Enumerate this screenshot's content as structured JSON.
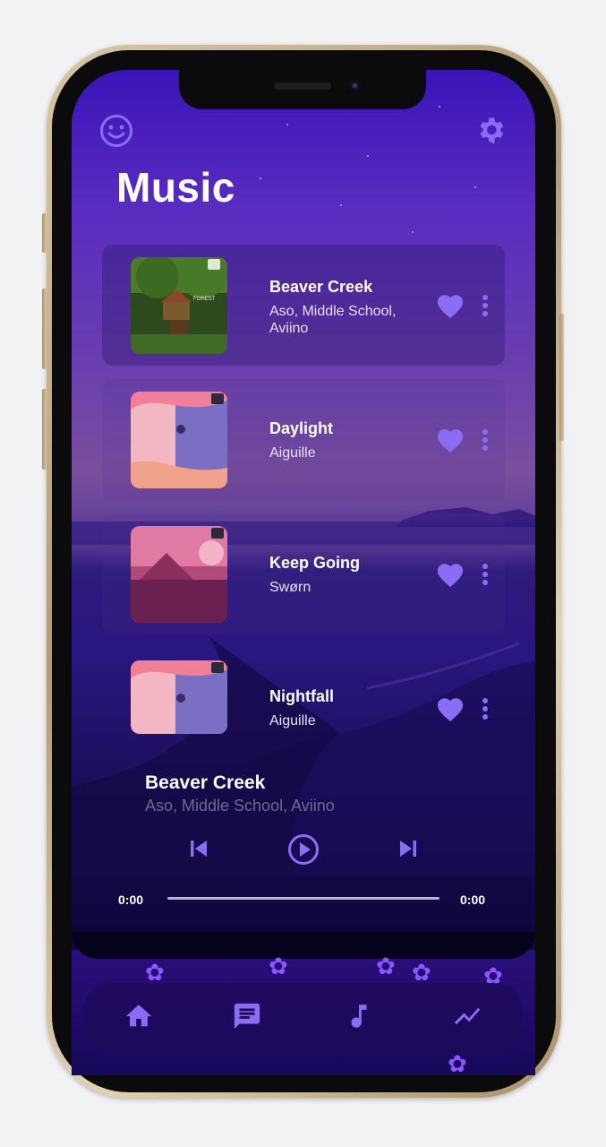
{
  "header": {
    "title": "Music",
    "left_icon": "smiley-icon",
    "right_icon": "gear-icon"
  },
  "songs": [
    {
      "title": "Beaver Creek",
      "artist": "Aso, Middle School, Aviino",
      "liked": true,
      "active": true
    },
    {
      "title": "Daylight",
      "artist": "Aiguille",
      "liked": true,
      "active": false
    },
    {
      "title": "Keep Going",
      "artist": "Swørn",
      "liked": true,
      "active": false
    },
    {
      "title": "Nightfall",
      "artist": "Aiguille",
      "liked": true,
      "active": false
    }
  ],
  "now_playing": {
    "title": "Beaver Creek",
    "artist": "Aso, Middle School, Aviino",
    "elapsed": "0:00",
    "duration": "0:00",
    "progress": 0
  },
  "nav": {
    "items": [
      "home-icon",
      "chat-icon",
      "music-note-icon",
      "trending-icon"
    ]
  },
  "colors": {
    "accent": "#8b6cf4",
    "background_top": "#3a14b8",
    "background_bottom": "#0a0330"
  }
}
